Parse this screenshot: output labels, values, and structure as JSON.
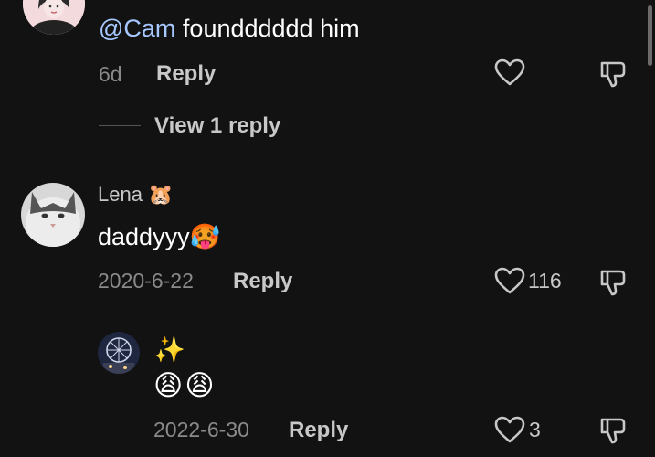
{
  "comments": [
    {
      "mention": "@Cam",
      "text": " foundddddd him",
      "time": "6d",
      "reply_label": "Reply",
      "like_count": "",
      "view_replies": "View 1 reply"
    },
    {
      "username": "Lena",
      "username_emoji": "🐹",
      "text": "daddyyy🥵",
      "time": "2020-6-22",
      "reply_label": "Reply",
      "like_count": "116"
    }
  ],
  "reply": {
    "text_line1": "✨",
    "text_line2": "😩😩",
    "time": "2022-6-30",
    "reply_label": "Reply",
    "like_count": "3"
  },
  "icons": {
    "like": "heart-outline",
    "dislike": "thumbs-down-outline"
  },
  "colors": {
    "background": "#121212",
    "mention": "#a6c8ff",
    "meta": "#8a8a8a"
  }
}
